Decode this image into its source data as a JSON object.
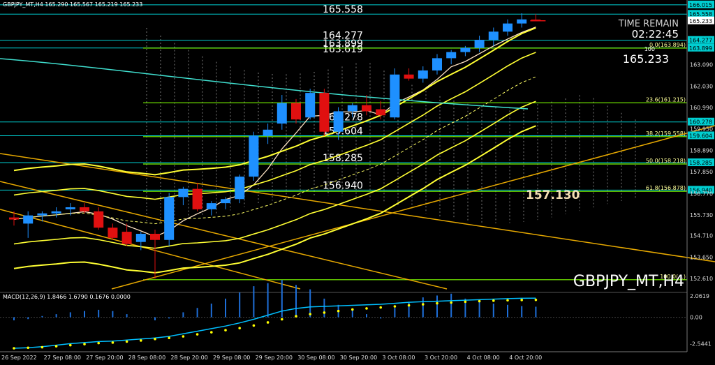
{
  "symbol_header": "GBPJPY_MT,H4  165.290 165.567 165.219 165.233",
  "watermark": "GBPJPY_MT,H4",
  "time_remain": {
    "label": "TIME REMAIN",
    "value": "02:22:45"
  },
  "current_price_label": "165.233",
  "callout_price": "157.130",
  "colors": {
    "background": "#000000",
    "bull": "#1e90ff",
    "bear": "#e01010",
    "yellow": "#ffff33",
    "orange": "#e6a800",
    "cyan_level": "#00ced1",
    "green_fib": "#7cfc00",
    "macd_hist": "#1e6fd9",
    "macd_signal": "#ffff00",
    "macd_line": "#00bfff"
  },
  "chart_data": [
    {
      "type": "line",
      "title": "GBPJPY_MT,H4",
      "ylim": [
        152.1,
        166.25
      ],
      "ytick_labels": [
        "166.015",
        "165.558",
        "165.233",
        "164.277",
        "163.899",
        "163.090",
        "162.030",
        "160.990",
        "160.278",
        "159.950",
        "159.604",
        "158.890",
        "158.285",
        "157.850",
        "156.940",
        "156.770",
        "155.730",
        "154.710",
        "153.650",
        "152.610"
      ],
      "x_tick_labels": [
        "26 Sep 2022",
        "27 Sep 08:00",
        "27 Sep 20:00",
        "28 Sep 08:00",
        "28 Sep 20:00",
        "29 Sep 08:00",
        "29 Sep 20:00",
        "30 Sep 08:00",
        "30 Sep 20:00",
        "3 Oct 08:00",
        "3 Oct 20:00",
        "4 Oct 08:00",
        "4 Oct 20:00"
      ],
      "candles": [
        {
          "o": 155.6,
          "h": 155.9,
          "l": 155.2,
          "c": 155.5
        },
        {
          "o": 155.3,
          "h": 155.9,
          "l": 154.6,
          "c": 155.7
        },
        {
          "o": 155.7,
          "h": 155.9,
          "l": 155.4,
          "c": 155.8
        },
        {
          "o": 155.8,
          "h": 156.1,
          "l": 155.6,
          "c": 155.9
        },
        {
          "o": 156.0,
          "h": 156.3,
          "l": 155.7,
          "c": 156.1
        },
        {
          "o": 156.1,
          "h": 156.3,
          "l": 155.8,
          "c": 155.9
        },
        {
          "o": 155.9,
          "h": 156.1,
          "l": 155.0,
          "c": 155.1
        },
        {
          "o": 155.1,
          "h": 155.3,
          "l": 154.5,
          "c": 154.6
        },
        {
          "o": 154.9,
          "h": 155.3,
          "l": 154.2,
          "c": 154.3
        },
        {
          "o": 154.4,
          "h": 154.9,
          "l": 154.0,
          "c": 154.8
        },
        {
          "o": 154.8,
          "h": 155.0,
          "l": 152.6,
          "c": 154.5
        },
        {
          "o": 154.5,
          "h": 156.8,
          "l": 154.2,
          "c": 156.6
        },
        {
          "o": 156.6,
          "h": 157.1,
          "l": 156.2,
          "c": 157.0
        },
        {
          "o": 157.0,
          "h": 157.3,
          "l": 155.9,
          "c": 156.0
        },
        {
          "o": 156.0,
          "h": 156.4,
          "l": 155.7,
          "c": 156.3
        },
        {
          "o": 156.3,
          "h": 156.6,
          "l": 156.0,
          "c": 156.5
        },
        {
          "o": 156.5,
          "h": 157.7,
          "l": 156.3,
          "c": 157.6
        },
        {
          "o": 157.6,
          "h": 159.8,
          "l": 157.4,
          "c": 159.6
        },
        {
          "o": 159.6,
          "h": 160.2,
          "l": 159.2,
          "c": 159.9
        },
        {
          "o": 160.2,
          "h": 161.6,
          "l": 159.9,
          "c": 161.2
        },
        {
          "o": 161.2,
          "h": 161.4,
          "l": 160.2,
          "c": 160.4
        },
        {
          "o": 160.5,
          "h": 161.9,
          "l": 160.4,
          "c": 161.7
        },
        {
          "o": 161.7,
          "h": 161.9,
          "l": 159.6,
          "c": 159.8
        },
        {
          "o": 159.8,
          "h": 161.0,
          "l": 159.4,
          "c": 160.8
        },
        {
          "o": 160.8,
          "h": 161.2,
          "l": 160.5,
          "c": 161.1
        },
        {
          "o": 161.1,
          "h": 161.6,
          "l": 160.6,
          "c": 160.8
        },
        {
          "o": 160.9,
          "h": 161.3,
          "l": 160.4,
          "c": 160.6
        },
        {
          "o": 160.5,
          "h": 162.9,
          "l": 160.4,
          "c": 162.6
        },
        {
          "o": 162.6,
          "h": 162.9,
          "l": 162.3,
          "c": 162.4
        },
        {
          "o": 162.4,
          "h": 163.0,
          "l": 162.2,
          "c": 162.8
        },
        {
          "o": 162.8,
          "h": 163.6,
          "l": 162.6,
          "c": 163.4
        },
        {
          "o": 163.4,
          "h": 163.8,
          "l": 163.1,
          "c": 163.7
        },
        {
          "o": 163.7,
          "h": 164.0,
          "l": 163.5,
          "c": 163.9
        },
        {
          "o": 163.9,
          "h": 164.5,
          "l": 163.7,
          "c": 164.3
        },
        {
          "o": 164.3,
          "h": 164.9,
          "l": 164.0,
          "c": 164.7
        },
        {
          "o": 164.7,
          "h": 165.3,
          "l": 164.5,
          "c": 165.1
        },
        {
          "o": 165.1,
          "h": 165.6,
          "l": 164.9,
          "c": 165.3
        },
        {
          "o": 165.29,
          "h": 165.567,
          "l": 165.219,
          "c": 165.233
        }
      ],
      "horizontal_levels": [
        {
          "price": 166.015,
          "label": "166.015",
          "color": "cyan"
        },
        {
          "price": 165.558,
          "label": "165.558",
          "color": "cyan"
        },
        {
          "price": 164.277,
          "label": "164.277",
          "color": "cyan"
        },
        {
          "price": 163.899,
          "label": "163.899",
          "color": "cyan"
        },
        {
          "price": 160.278,
          "label": "160.278",
          "color": "cyan"
        },
        {
          "price": 159.604,
          "label": "159.604",
          "color": "cyan"
        },
        {
          "price": 158.285,
          "label": "158.285",
          "color": "cyan"
        },
        {
          "price": 156.94,
          "label": "156.940",
          "color": "cyan"
        }
      ],
      "level_captions": [
        "165.558",
        "164.277",
        "163.899",
        "163.619",
        "160.278",
        "159.604",
        "158.285",
        "156.940"
      ],
      "fib_levels": [
        {
          "label": "0.0(163.894)",
          "price": 163.894
        },
        {
          "label": "23.6(161.215)",
          "price": 161.215
        },
        {
          "label": "38.2(159.558)",
          "price": 159.558
        },
        {
          "label": "50.0(158.218)",
          "price": 158.218
        },
        {
          "label": "61.8(156.878)",
          "price": 156.878
        },
        {
          "label": "100.0(...)",
          "price": 152.55
        }
      ],
      "fib_marker": "100"
    },
    {
      "type": "bar",
      "title": "MACD(12,26,9) 1.8466 1.6790 0.1676 0.0000",
      "ylim": [
        -3.2,
        2.4
      ],
      "ytick_labels": [
        "2.0619",
        "0.00",
        "-2.5441"
      ],
      "histogram": [
        -0.05,
        -0.03,
        0.02,
        0.05,
        0.08,
        0.1,
        0.12,
        0.1,
        0.05,
        0.0,
        -0.05,
        -0.02,
        0.08,
        0.15,
        0.22,
        0.3,
        0.4,
        0.5,
        0.55,
        0.6,
        0.52,
        0.45,
        0.3,
        0.2,
        0.12,
        0.05,
        -0.02,
        0.15,
        0.25,
        0.32,
        0.35,
        0.38,
        0.3,
        0.28,
        0.22,
        0.2,
        0.18,
        0.17
      ],
      "macd_line": [
        -3.0,
        -2.95,
        -2.85,
        -2.7,
        -2.55,
        -2.45,
        -2.35,
        -2.3,
        -2.2,
        -2.1,
        -2.0,
        -1.85,
        -1.6,
        -1.35,
        -1.1,
        -0.85,
        -0.55,
        -0.2,
        0.2,
        0.6,
        0.85,
        1.0,
        1.05,
        1.1,
        1.15,
        1.2,
        1.25,
        1.35,
        1.45,
        1.5,
        1.55,
        1.6,
        1.65,
        1.7,
        1.75,
        1.8,
        1.83,
        1.85
      ],
      "signal_line": [
        -3.0,
        -2.95,
        -2.9,
        -2.8,
        -2.7,
        -2.6,
        -2.5,
        -2.45,
        -2.35,
        -2.25,
        -2.1,
        -2.0,
        -1.85,
        -1.65,
        -1.45,
        -1.25,
        -1.05,
        -0.8,
        -0.5,
        -0.2,
        0.1,
        0.3,
        0.45,
        0.6,
        0.75,
        0.85,
        0.95,
        1.05,
        1.15,
        1.25,
        1.35,
        1.42,
        1.5,
        1.55,
        1.6,
        1.64,
        1.67,
        1.68
      ]
    }
  ]
}
